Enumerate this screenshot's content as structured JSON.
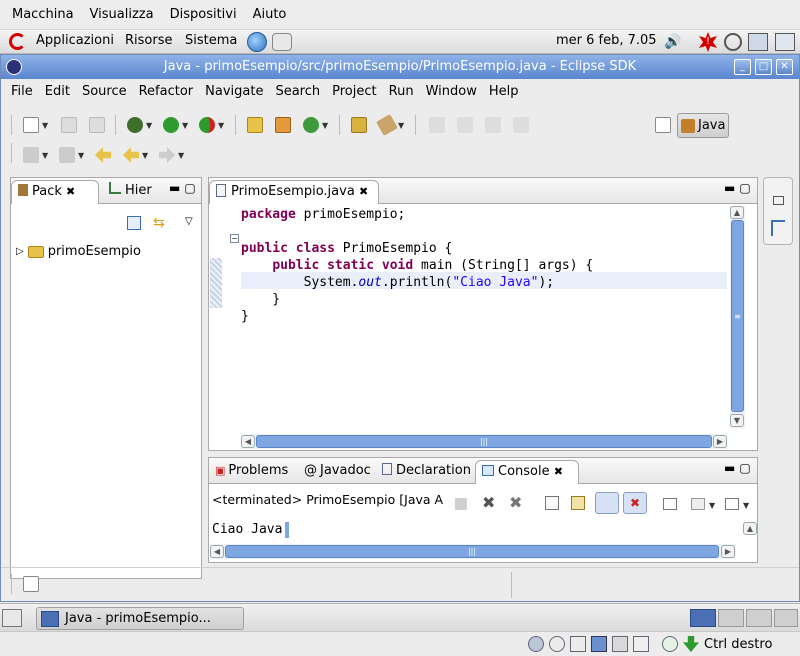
{
  "vm_menu": [
    "Macchina",
    "Visualizza",
    "Dispositivi",
    "Aiuto"
  ],
  "panel": {
    "apps": "Applicazioni",
    "places": "Risorse",
    "system": "Sistema",
    "clock": "mer  6 feb, 7.05"
  },
  "window": {
    "title": "Java - primoEsempio/src/primoEsempio/PrimoEsempio.java - Eclipse SDK"
  },
  "menubar": [
    "File",
    "Edit",
    "Source",
    "Refactor",
    "Navigate",
    "Search",
    "Project",
    "Run",
    "Window",
    "Help"
  ],
  "perspective": {
    "label": "Java"
  },
  "left_panel": {
    "tabs": [
      "Pack",
      "Hier"
    ],
    "tree": [
      {
        "label": "primoEsempio"
      }
    ]
  },
  "editor": {
    "tab": "PrimoEsempio.java",
    "lines": [
      [
        {
          "t": "package",
          "c": "kw"
        },
        {
          "t": " primoEsempio;",
          "c": ""
        }
      ],
      [],
      [
        {
          "t": "public",
          "c": "kw"
        },
        {
          "t": " ",
          "c": ""
        },
        {
          "t": "class",
          "c": "kw"
        },
        {
          "t": " PrimoEsempio {",
          "c": ""
        }
      ],
      [
        {
          "t": "    ",
          "c": ""
        },
        {
          "t": "public",
          "c": "kw"
        },
        {
          "t": " ",
          "c": ""
        },
        {
          "t": "static",
          "c": "kw"
        },
        {
          "t": " ",
          "c": ""
        },
        {
          "t": "void",
          "c": "kw"
        },
        {
          "t": " main (String[] args) {",
          "c": ""
        }
      ],
      [
        {
          "t": "        System.",
          "c": ""
        },
        {
          "t": "out",
          "c": "it"
        },
        {
          "t": ".println(",
          "c": ""
        },
        {
          "t": "\"Ciao Java\"",
          "c": "str"
        },
        {
          "t": ");",
          "c": ""
        }
      ],
      [
        {
          "t": "    }",
          "c": ""
        }
      ],
      [
        {
          "t": "}",
          "c": ""
        }
      ]
    ]
  },
  "bottom": {
    "tabs": [
      "Problems",
      "Javadoc",
      "Declaration",
      "Console"
    ],
    "status": "<terminated> PrimoEsempio [Java A",
    "output": "Ciao Java"
  },
  "taskbar": {
    "item": "Java - primoEsempio..."
  },
  "vmstatus": {
    "host_key": "Ctrl destro"
  }
}
